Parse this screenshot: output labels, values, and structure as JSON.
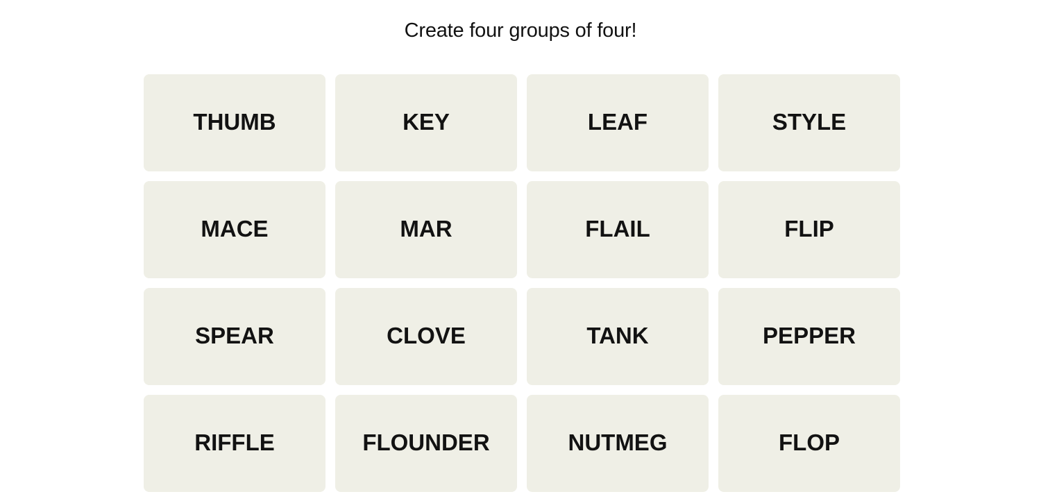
{
  "header": {
    "prompt": "Create four groups of four!"
  },
  "board": {
    "tile_color": "#efefe6",
    "text_color": "#121212",
    "tiles": [
      {
        "word": "THUMB"
      },
      {
        "word": "KEY"
      },
      {
        "word": "LEAF"
      },
      {
        "word": "STYLE"
      },
      {
        "word": "MACE"
      },
      {
        "word": "MAR"
      },
      {
        "word": "FLAIL"
      },
      {
        "word": "FLIP"
      },
      {
        "word": "SPEAR"
      },
      {
        "word": "CLOVE"
      },
      {
        "word": "TANK"
      },
      {
        "word": "PEPPER"
      },
      {
        "word": "RIFFLE"
      },
      {
        "word": "FLOUNDER"
      },
      {
        "word": "NUTMEG"
      },
      {
        "word": "FLOP"
      }
    ]
  }
}
